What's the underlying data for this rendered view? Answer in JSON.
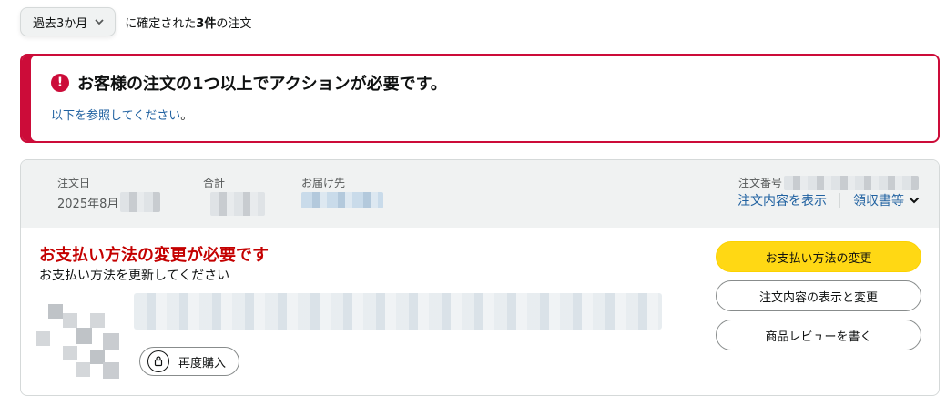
{
  "filter": {
    "period_label": "過去3か月",
    "prefix_text": "に確定された",
    "count_text": "3件",
    "suffix_text": "の注文"
  },
  "alert": {
    "icon": "exclamation-icon",
    "title": "お客様の注文の1つ以上でアクションが必要です。",
    "link_text": "以下を参照してください",
    "link_suffix": "。"
  },
  "order": {
    "date_label": "注文日",
    "date_value": "2025年8月",
    "total_label": "合計",
    "ship_label": "お届け先",
    "order_no_label": "注文番号",
    "view_details_link": "注文内容を表示",
    "receipt_link": "領収書等",
    "status_title": "お支払い方法の変更が必要です",
    "status_sub": "お支払い方法を更新してください",
    "buy_again_label": "再度購入",
    "actions": {
      "change_payment": "お支払い方法の変更",
      "view_edit": "注文内容の表示と変更",
      "write_review": "商品レビューを書く"
    }
  },
  "colors": {
    "alert_red": "#cc0c39",
    "status_red": "#c40000",
    "link_blue": "#2162a1",
    "primary_yellow": "#ffd814"
  }
}
